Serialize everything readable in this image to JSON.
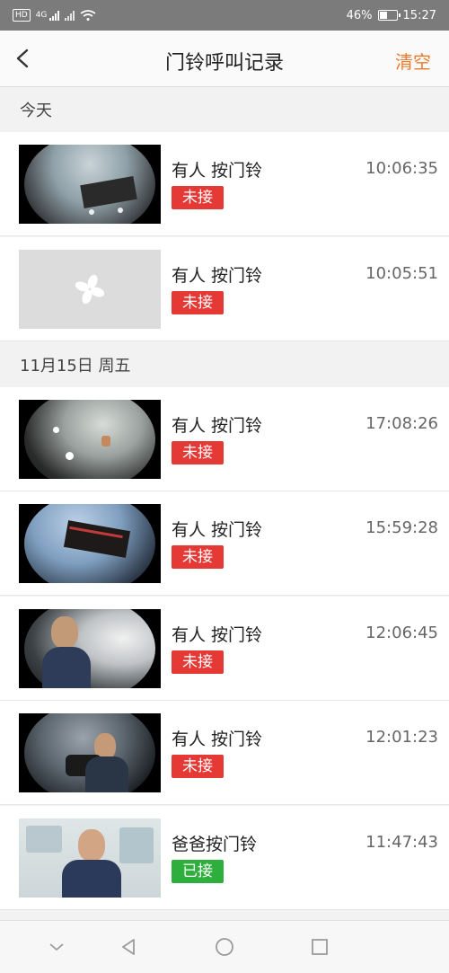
{
  "status": {
    "hd": "HD",
    "network": "4G",
    "battery": "46%",
    "battery_level": 0.46,
    "time": "15:27"
  },
  "nav": {
    "title": "门铃呼叫记录",
    "clear_label": "清空"
  },
  "colors": {
    "accent": "#f07a2c",
    "missed": "#e53935",
    "answered": "#2eae3c"
  },
  "sections": [
    {
      "label": "今天"
    },
    {
      "label": "11月15日 周五"
    }
  ],
  "records": [
    {
      "text": "有人 按门铃",
      "time": "10:06:35",
      "status": "未接",
      "status_type": "missed"
    },
    {
      "text": "有人 按门铃",
      "time": "10:05:51",
      "status": "未接",
      "status_type": "missed"
    },
    {
      "text": "有人 按门铃",
      "time": "17:08:26",
      "status": "未接",
      "status_type": "missed"
    },
    {
      "text": "有人 按门铃",
      "time": "15:59:28",
      "status": "未接",
      "status_type": "missed"
    },
    {
      "text": "有人 按门铃",
      "time": "12:06:45",
      "status": "未接",
      "status_type": "missed"
    },
    {
      "text": "有人 按门铃",
      "time": "12:01:23",
      "status": "未接",
      "status_type": "missed"
    },
    {
      "text": "爸爸按门铃",
      "time": "11:47:43",
      "status": "已接",
      "status_type": "answered"
    }
  ],
  "icons": {
    "back": "chevron-left-icon",
    "placeholder": "fan-logo-icon",
    "sys_back": "triangle-back-icon",
    "sys_home": "circle-home-icon",
    "sys_recent": "square-recent-icon",
    "sys_collapse": "chevron-down-icon"
  }
}
